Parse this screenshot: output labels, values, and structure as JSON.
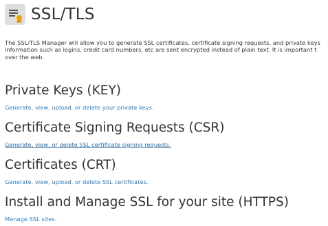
{
  "header": {
    "icon": "certificate-document-icon",
    "title": "SSL/TLS"
  },
  "intro": {
    "line1": "The SSL/TLS Manager will allow you to generate SSL certificates, certificate signing requests, and private keys",
    "line2": "information such as logins, credit card numbers, etc are sent encrypted instead of plain text. It is important t",
    "line3": "over the web."
  },
  "sections": [
    {
      "title": "Private Keys (KEY)",
      "link": "Generate, view, upload, or delete your private keys."
    },
    {
      "title": "Certificate Signing Requests (CSR)",
      "link": "Generate, view, or delete SSL certificate signing requests."
    },
    {
      "title": "Certificates (CRT)",
      "link": "Generate, view, upload, or delete SSL certificates."
    },
    {
      "title": "Install and Manage SSL for your site (HTTPS)",
      "link": "Manage SSL sites."
    }
  ],
  "colors": {
    "link": "#2f7ab8",
    "text": "#333333",
    "icon_bg": "#dcdcdc",
    "icon_accent": "#f0a30a"
  }
}
